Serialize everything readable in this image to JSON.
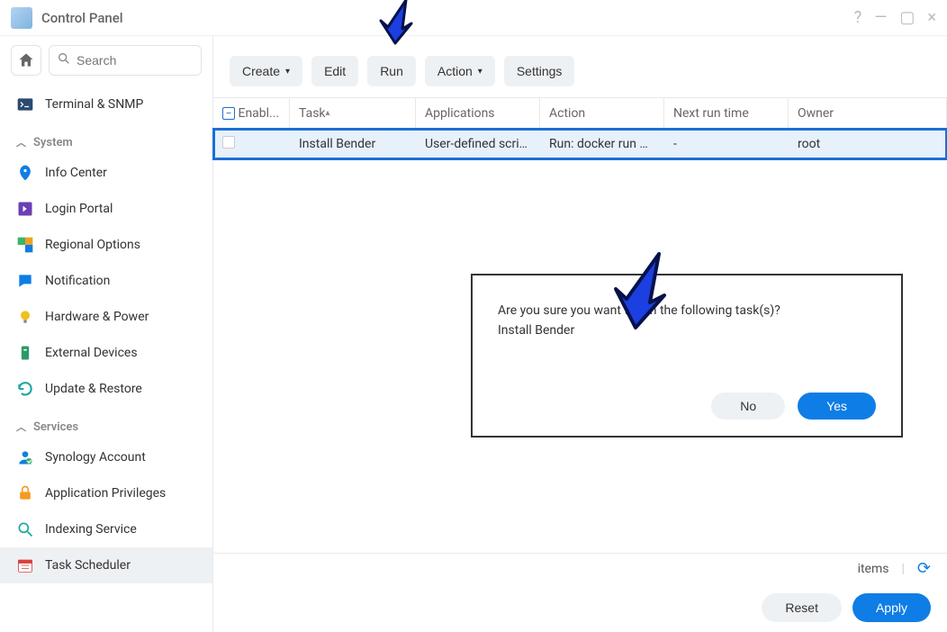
{
  "window": {
    "title": "Control Panel"
  },
  "search": {
    "placeholder": "Search"
  },
  "sidebar": {
    "top_item": "Terminal & SNMP",
    "section_system": {
      "label": "System",
      "items": [
        "Info Center",
        "Login Portal",
        "Regional Options",
        "Notification",
        "Hardware & Power",
        "External Devices",
        "Update & Restore"
      ]
    },
    "section_services": {
      "label": "Services",
      "items": [
        "Synology Account",
        "Application Privileges",
        "Indexing Service",
        "Task Scheduler"
      ]
    }
  },
  "toolbar": {
    "create": "Create",
    "edit": "Edit",
    "run": "Run",
    "action": "Action",
    "settings": "Settings"
  },
  "table": {
    "headers": {
      "enable": "Enabl...",
      "task": "Task",
      "apps": "Applications",
      "action": "Action",
      "next": "Next run time",
      "owner": "Owner"
    },
    "rows": [
      {
        "task": "Install Bender",
        "apps": "User-defined scri…",
        "action": "Run: docker run …",
        "next": "-",
        "owner": "root"
      }
    ]
  },
  "status": {
    "items": "items"
  },
  "footer": {
    "reset": "Reset",
    "apply": "Apply"
  },
  "dialog": {
    "line1": "Are you sure you want to run the following task(s)?",
    "line2": "Install Bender",
    "no": "No",
    "yes": "Yes"
  }
}
